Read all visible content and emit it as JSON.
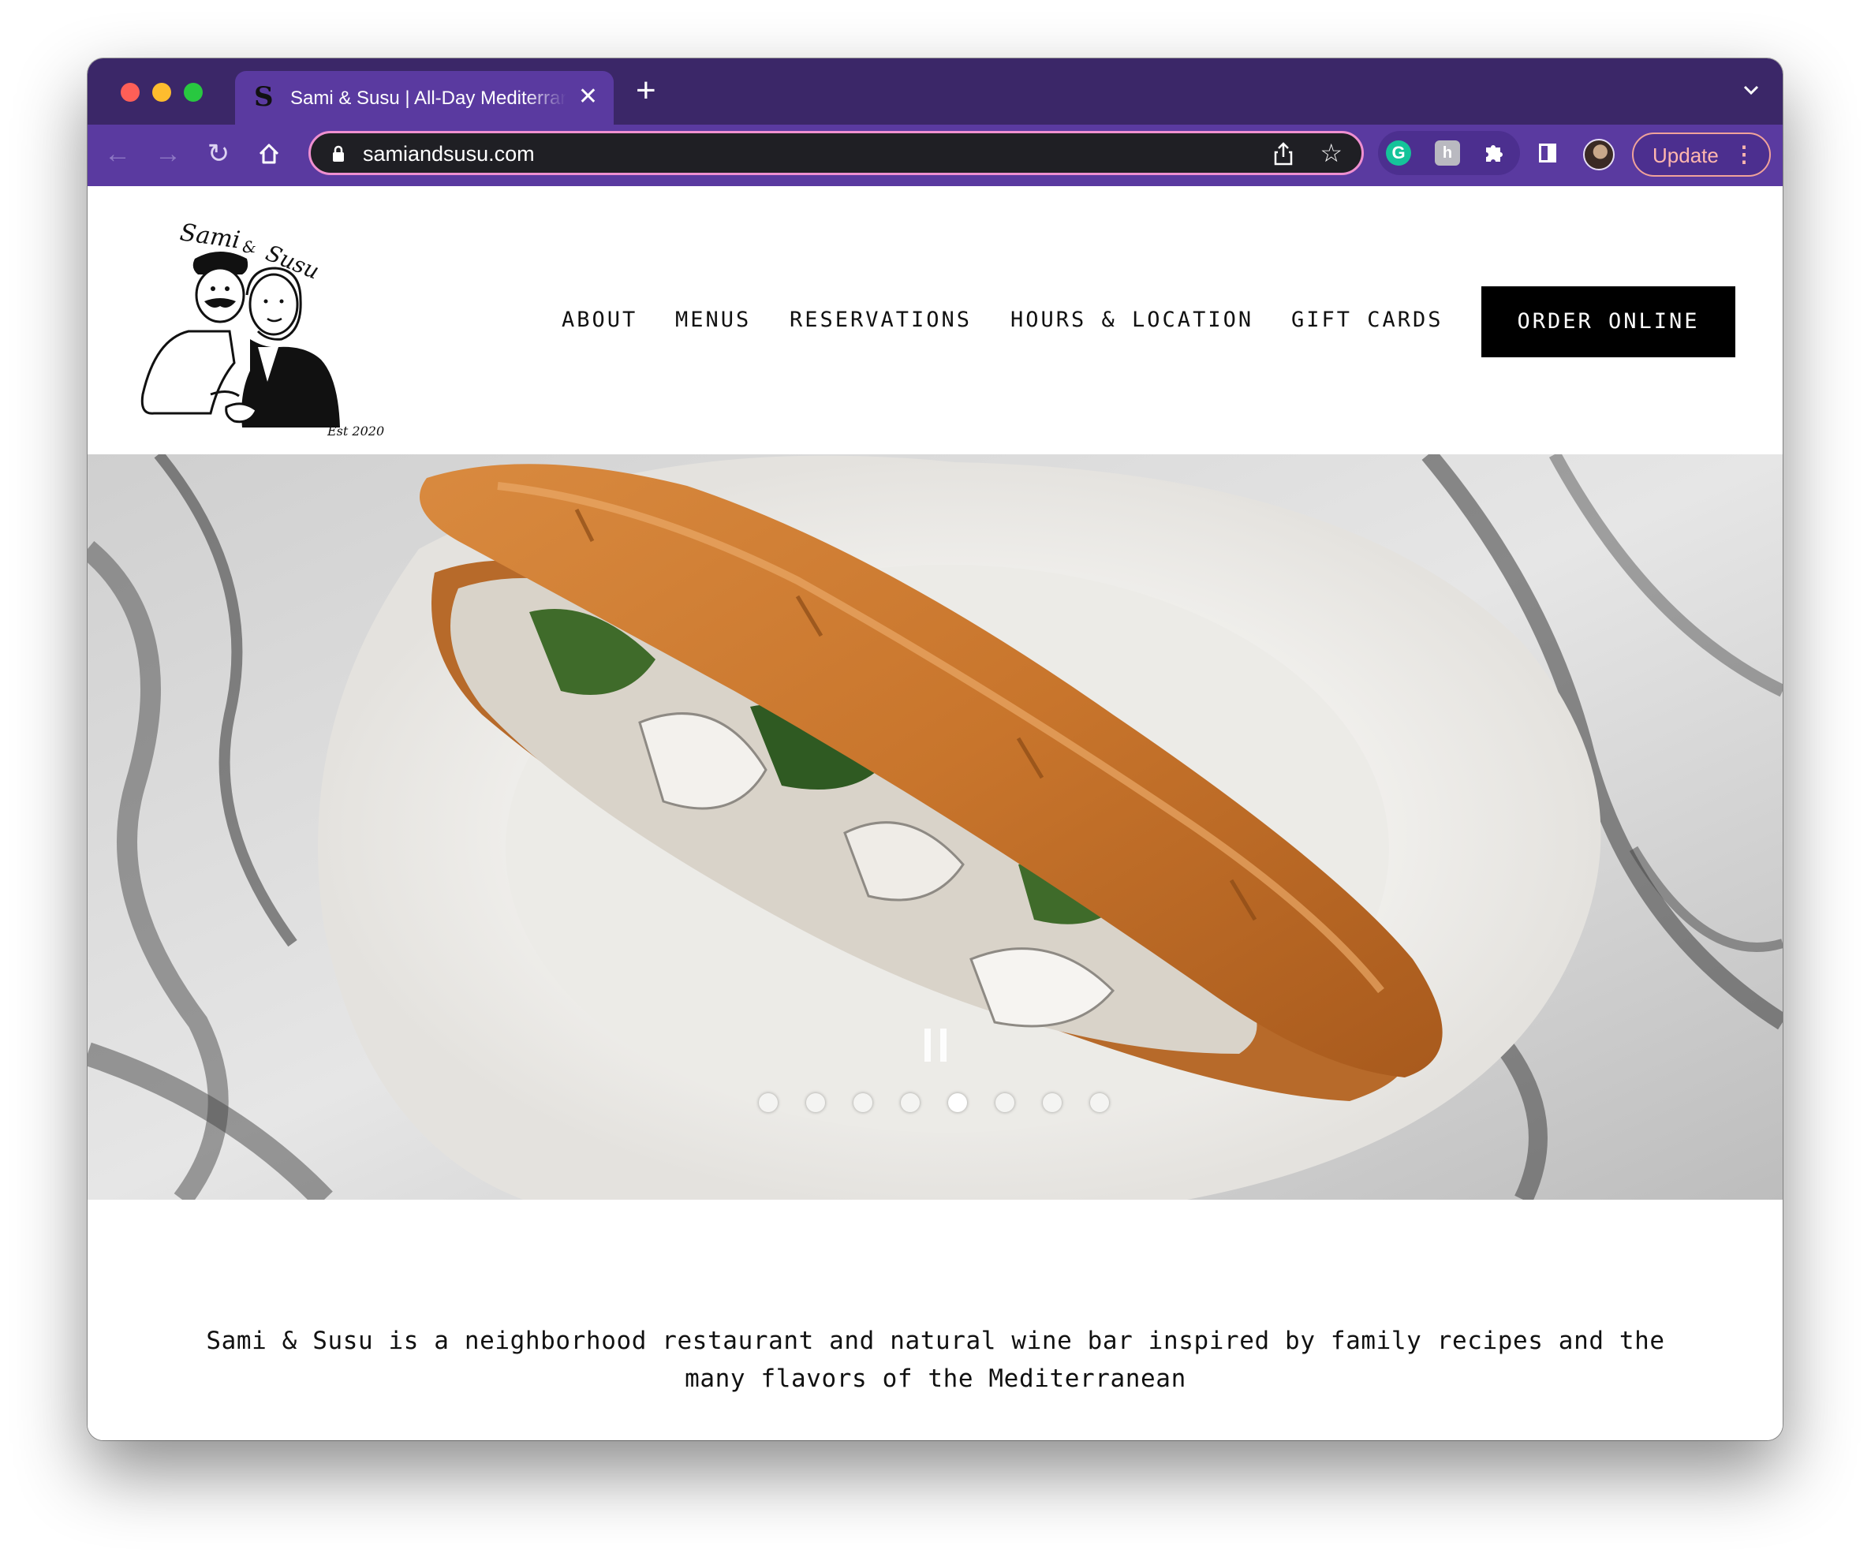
{
  "browser": {
    "tab_title": "Sami & Susu | All-Day Mediterranean",
    "tab_favicon": "S",
    "url": "samiandsusu.com",
    "update_label": "Update",
    "extensions": [
      "grammarly-extension",
      "honey-extension"
    ],
    "colors": {
      "tab_strip": "#3b2768",
      "toolbar": "#5a3aa0",
      "omnibox_border": "#ef8fd0",
      "update_text": "#ffb7ae"
    }
  },
  "site": {
    "logo": {
      "name": "Sami & Susu",
      "established": "Est 2020"
    },
    "nav": [
      {
        "label": "ABOUT"
      },
      {
        "label": "MENUS"
      },
      {
        "label": "RESERVATIONS"
      },
      {
        "label": "HOURS & LOCATION"
      },
      {
        "label": "GIFT CARDS"
      }
    ],
    "order_button": "ORDER ONLINE",
    "hero": {
      "image": "sardine sandwich on baguette, white scalloped plate, marble table",
      "slide_count": 8,
      "active_slide": 5
    },
    "tagline": "Sami & Susu is a neighborhood restaurant and natural wine bar inspired by family recipes and the many flavors of the Mediterranean"
  }
}
